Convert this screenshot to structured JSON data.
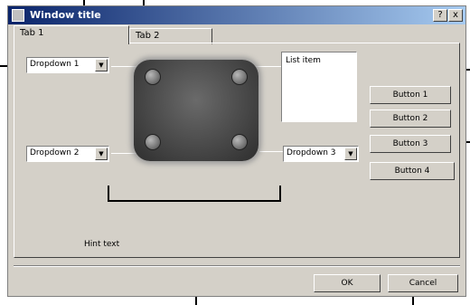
{
  "window": {
    "title": "Window title"
  },
  "title_buttons": {
    "help": "?",
    "close": "x"
  },
  "tabs": [
    {
      "label": "Tab 1"
    },
    {
      "label": "Tab 2"
    }
  ],
  "combos": [
    {
      "value": "Dropdown 1"
    },
    {
      "value": "Dropdown 2"
    },
    {
      "value": "Dropdown 3"
    }
  ],
  "listbox": {
    "selected": "List item"
  },
  "buttons": [
    {
      "label": "Button 1"
    },
    {
      "label": "Button 2"
    },
    {
      "label": "Button 3"
    },
    {
      "label": "Button 4"
    }
  ],
  "hint": "Hint text",
  "footer": {
    "ok": "OK",
    "cancel": "Cancel"
  },
  "icons": {
    "dropdown": "triangle-down"
  }
}
